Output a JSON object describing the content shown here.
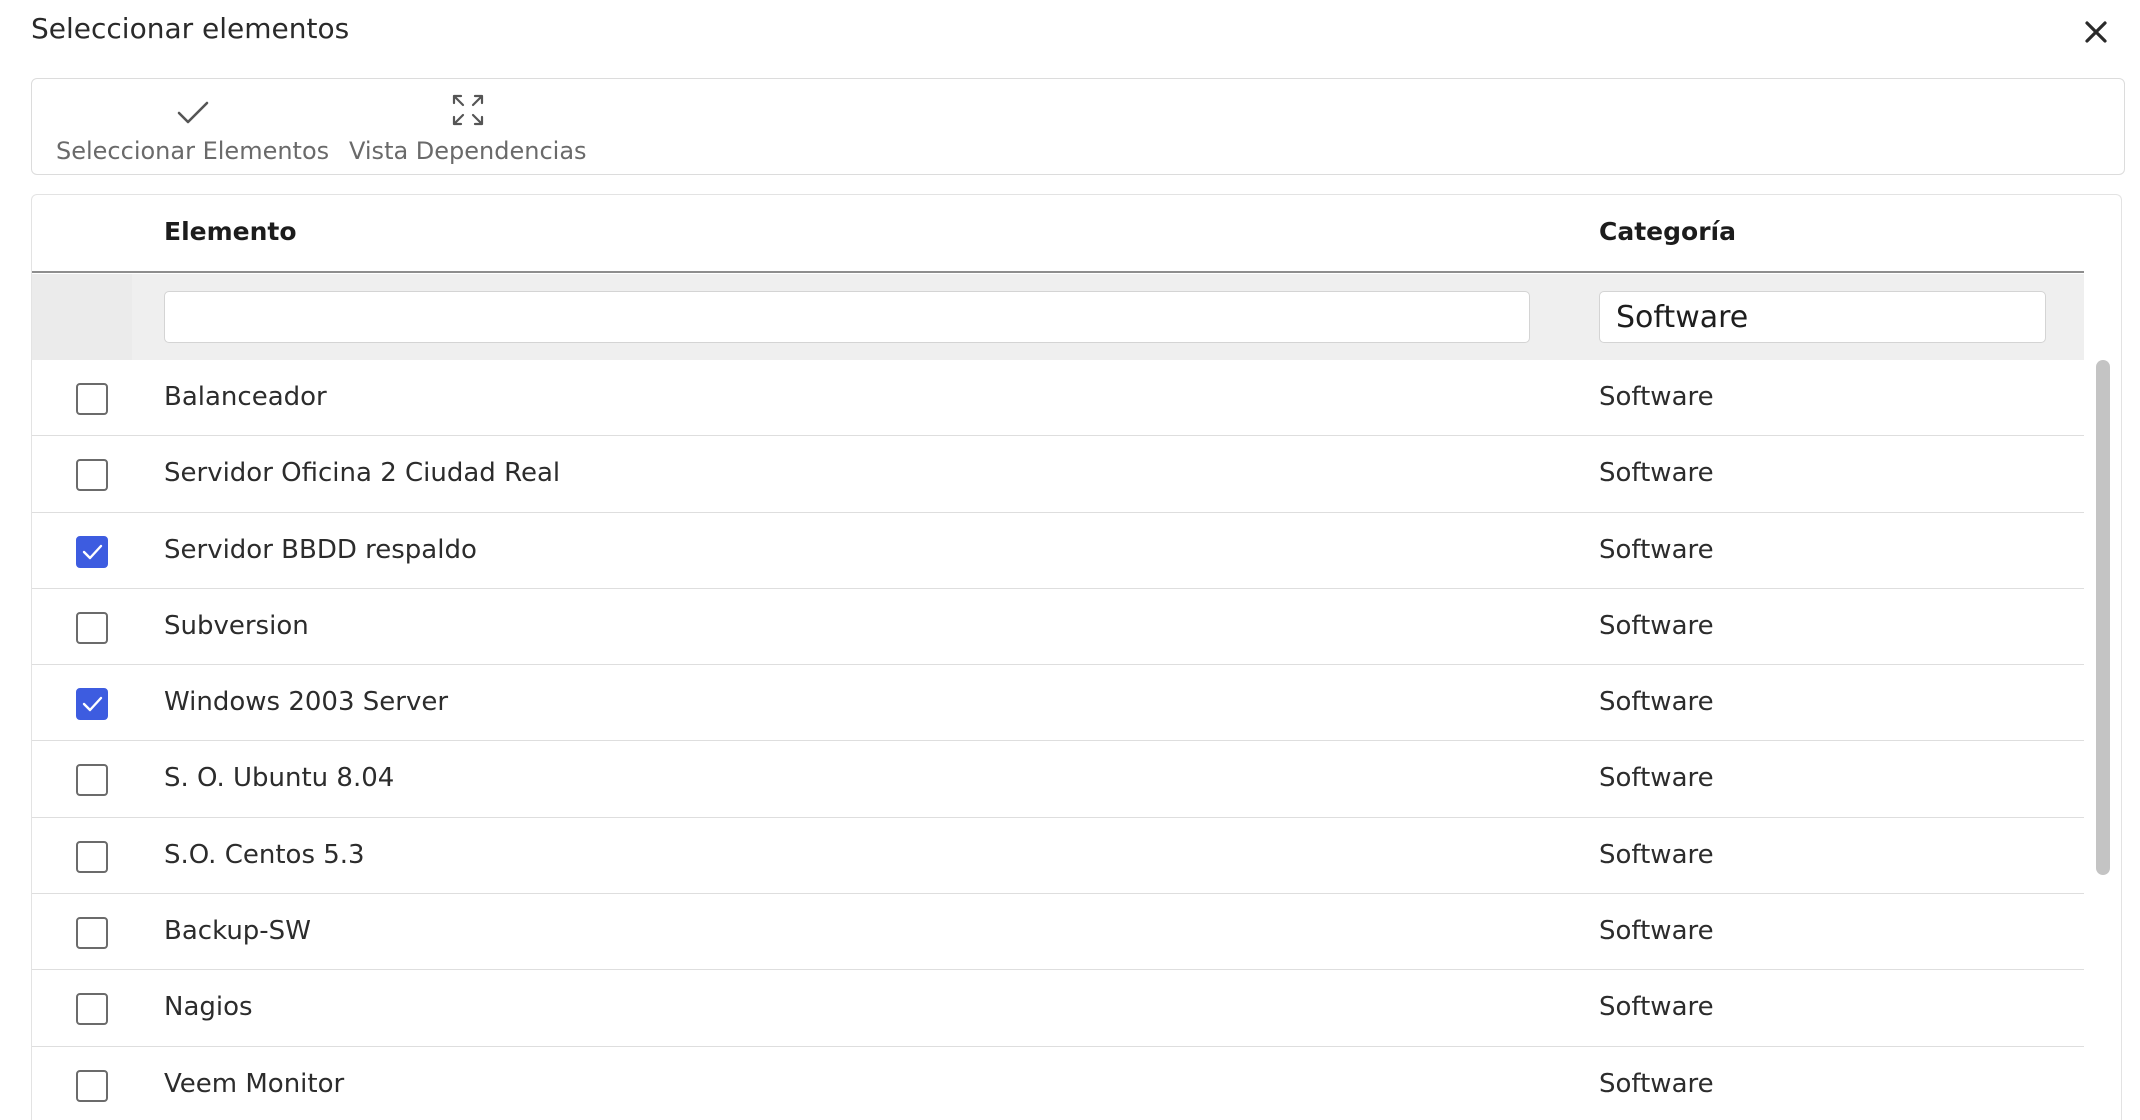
{
  "dialog": {
    "title": "Seleccionar elementos",
    "close_icon": "close-icon"
  },
  "toolbar": {
    "select": {
      "label": "Seleccionar Elementos",
      "icon": "check-icon"
    },
    "deps": {
      "label": "Vista Dependencias",
      "icon": "expand-icon"
    }
  },
  "table": {
    "columns": {
      "elemento": "Elemento",
      "categoria": "Categoría"
    },
    "filters": {
      "elemento": "",
      "categoria": "Software"
    },
    "rows": [
      {
        "checked": false,
        "elemento": "Balanceador",
        "categoria": "Software"
      },
      {
        "checked": false,
        "elemento": "Servidor Oficina 2 Ciudad Real",
        "categoria": "Software"
      },
      {
        "checked": true,
        "elemento": "Servidor BBDD respaldo",
        "categoria": "Software"
      },
      {
        "checked": false,
        "elemento": "Subversion",
        "categoria": "Software"
      },
      {
        "checked": true,
        "elemento": "Windows 2003 Server",
        "categoria": "Software"
      },
      {
        "checked": false,
        "elemento": "S. O. Ubuntu 8.04",
        "categoria": "Software"
      },
      {
        "checked": false,
        "elemento": "S.O. Centos 5.3",
        "categoria": "Software"
      },
      {
        "checked": false,
        "elemento": "Backup-SW",
        "categoria": "Software"
      },
      {
        "checked": false,
        "elemento": "Nagios",
        "categoria": "Software"
      },
      {
        "checked": false,
        "elemento": "Veem Monitor",
        "categoria": "Software"
      }
    ]
  },
  "colors": {
    "accent": "#3d5ce0",
    "header_border": "#8e8e8e",
    "filter_bg": "#efefef"
  }
}
